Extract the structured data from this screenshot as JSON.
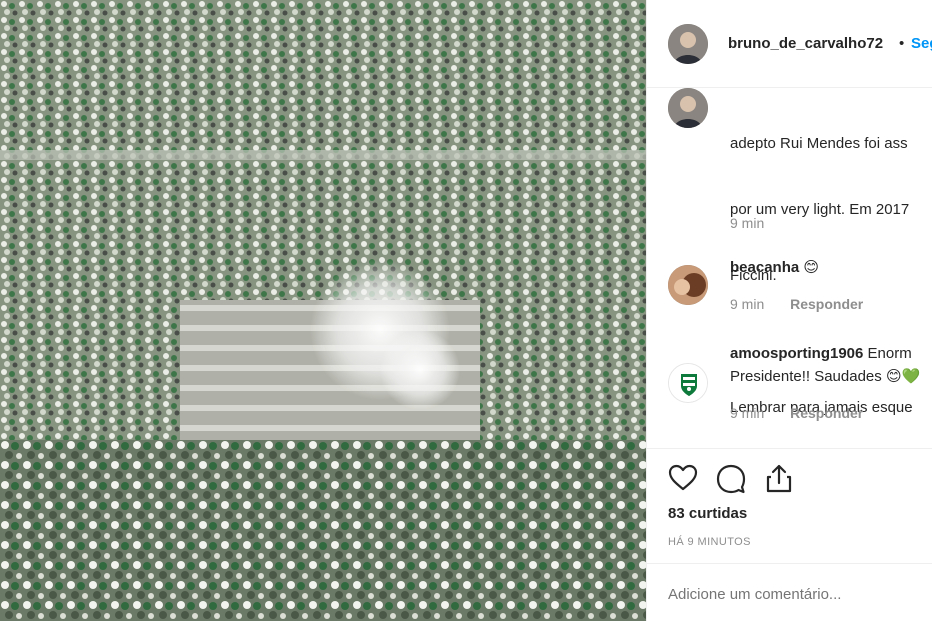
{
  "post": {
    "image_alt": "",
    "username": "bruno_de_carvalho72",
    "separator": "•",
    "follow_label": "Seg"
  },
  "caption": {
    "lines": [
      "adepto Rui Mendes foi ass",
      "por um very light. Em 2017",
      "Ficcini.",
      "",
      "Lembrar para jamais esque"
    ],
    "time": "9 min"
  },
  "comments": [
    {
      "user": "beacanha",
      "emoji": "😊",
      "text": "",
      "time": "9 min",
      "reply": "Responder"
    },
    {
      "user": "amoosporting1906",
      "text_inline": "Enorm",
      "text": "Presidente!! Saudades 😊💚",
      "time": "9 min",
      "reply": "Responder"
    }
  ],
  "actions": {
    "like_icon": "heart-icon",
    "comment_icon": "comment-icon",
    "share_icon": "share-icon"
  },
  "likes": "83 curtidas",
  "timestamp": "HÁ 9 MINUTOS",
  "add_comment_placeholder": "Adicione um comentário..."
}
